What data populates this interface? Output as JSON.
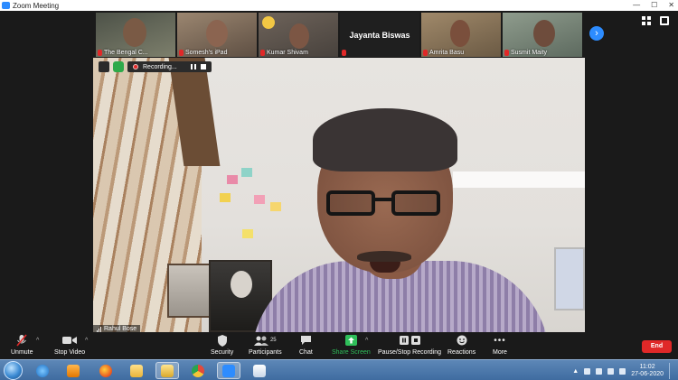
{
  "window": {
    "title": "Zoom Meeting",
    "controls": [
      "—",
      "☐",
      "✕"
    ]
  },
  "thumbnails": [
    {
      "name": "The Bengal C...",
      "muted": true,
      "bg": "#5a5e52"
    },
    {
      "name": "Somesh's iPad",
      "muted": true,
      "bg": "#7a6a5b"
    },
    {
      "name": "Kumar Shivam",
      "muted": true,
      "bg": "#6b5f57"
    },
    {
      "name": "Jayanta Biswas",
      "muted": true,
      "video_off": true,
      "bg": "#1f1f1f"
    },
    {
      "name": "Amrita Basu",
      "muted": true,
      "bg": "#8a7a60"
    },
    {
      "name": "Susmit Maity",
      "muted": true,
      "bg": "#7b8a7c"
    }
  ],
  "next_page_icon": "chevron-right-icon",
  "recording": {
    "label": "Recording..."
  },
  "speaker": {
    "name": "Rahul Bose"
  },
  "toolbar": {
    "unmute": "Unmute",
    "stop_video": "Stop Video",
    "security": "Security",
    "participants": "Participants",
    "participants_count": "25",
    "chat": "Chat",
    "share_screen": "Share Screen",
    "pause_stop_recording": "Pause/Stop Recording",
    "reactions": "Reactions",
    "more": "More",
    "end": "End"
  },
  "taskbar": {
    "apps": [
      "windows-explorer",
      "internet-explorer",
      "media-player",
      "firefox",
      "file-explorer",
      "photo-viewer",
      "chrome",
      "zoom",
      "paint"
    ],
    "time": "11:02",
    "date": "27-06-2020"
  },
  "colors": {
    "accent": "#2d8cff",
    "end": "#e02828",
    "share": "#2fbf5a",
    "mic_off": "#e02828"
  }
}
